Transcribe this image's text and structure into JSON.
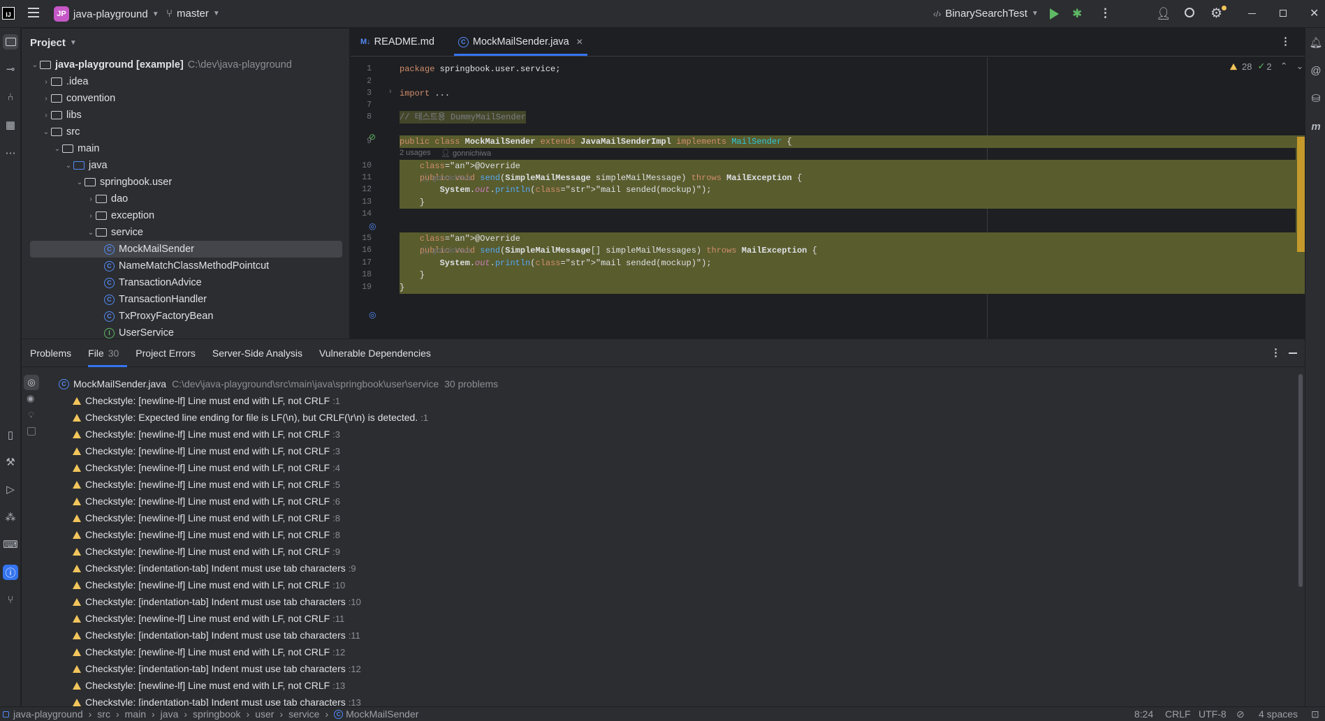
{
  "titlebar": {
    "project_badge": "JP",
    "project_name": "java-playground",
    "branch": "master",
    "run_config": "BinarySearchTest"
  },
  "project_panel": {
    "title": "Project",
    "tree": [
      {
        "label": "java-playground [example]",
        "extra": "C:\\dev\\java-playground",
        "type": "root",
        "depth": 0,
        "open": true
      },
      {
        "label": ".idea",
        "type": "folder",
        "depth": 1,
        "open": false
      },
      {
        "label": "convention",
        "type": "folder",
        "depth": 1,
        "open": false
      },
      {
        "label": "libs",
        "type": "folder",
        "depth": 1,
        "open": false
      },
      {
        "label": "src",
        "type": "folder",
        "depth": 1,
        "open": true
      },
      {
        "label": "main",
        "type": "folder",
        "depth": 2,
        "open": true
      },
      {
        "label": "java",
        "type": "folder",
        "depth": 3,
        "open": true
      },
      {
        "label": "springbook.user",
        "type": "package",
        "depth": 4,
        "open": true
      },
      {
        "label": "dao",
        "type": "package",
        "depth": 5,
        "open": false
      },
      {
        "label": "exception",
        "type": "package",
        "depth": 5,
        "open": false
      },
      {
        "label": "service",
        "type": "package",
        "depth": 5,
        "open": true
      },
      {
        "label": "MockMailSender",
        "type": "class",
        "depth": 6,
        "selected": true
      },
      {
        "label": "NameMatchClassMethodPointcut",
        "type": "class",
        "depth": 6
      },
      {
        "label": "TransactionAdvice",
        "type": "class",
        "depth": 6
      },
      {
        "label": "TransactionHandler",
        "type": "class",
        "depth": 6
      },
      {
        "label": "TxProxyFactoryBean",
        "type": "class",
        "depth": 6
      },
      {
        "label": "UserService",
        "type": "interface",
        "depth": 6
      }
    ]
  },
  "editor": {
    "tabs": [
      {
        "label": "README.md",
        "icon": "M↓"
      },
      {
        "label": "MockMailSender.java",
        "icon": "C",
        "active": true
      }
    ],
    "warnings_count": "28",
    "checks_count": "2",
    "hint_usages": "2 usages",
    "hint_author": "gonnichiwa",
    "lines": [
      {
        "no": "1",
        "code": "package springbook.user.service;"
      },
      {
        "no": "2",
        "code": ""
      },
      {
        "no": "3",
        "code": "import ..."
      },
      {
        "no": "7",
        "code": ""
      },
      {
        "no": "8",
        "code": "// 테스트용 DummyMailSender"
      },
      {
        "no": "9",
        "code": "public class MockMailSender extends JavaMailSenderImpl implements MailSender {"
      },
      {
        "no": "10",
        "code": "    @Override"
      },
      {
        "no": "11",
        "code": "    public void send(SimpleMailMessage simpleMailMessage) throws MailException {"
      },
      {
        "no": "12",
        "code": "        System.out.println(\"mail sended(mockup)\");"
      },
      {
        "no": "13",
        "code": "    }"
      },
      {
        "no": "14",
        "code": ""
      },
      {
        "no": "15",
        "code": "    @Override"
      },
      {
        "no": "16",
        "code": "    public void send(SimpleMailMessage[] simpleMailMessages) throws MailException {"
      },
      {
        "no": "17",
        "code": "        System.out.println(\"mail sended(mockup)\");"
      },
      {
        "no": "18",
        "code": "    }"
      },
      {
        "no": "19",
        "code": "}"
      }
    ]
  },
  "problems": {
    "tabs": [
      {
        "label": "Problems"
      },
      {
        "label": "File",
        "count": "30",
        "active": true
      },
      {
        "label": "Project Errors"
      },
      {
        "label": "Server-Side Analysis"
      },
      {
        "label": "Vulnerable Dependencies"
      }
    ],
    "file_name": "MockMailSender.java",
    "file_path": "C:\\dev\\java-playground\\src\\main\\java\\springbook\\user\\service",
    "file_count": "30 problems",
    "items": [
      {
        "text": "Checkstyle: [newline-lf] Line must end with LF, not CRLF",
        "line": ":1"
      },
      {
        "text": "Checkstyle: Expected line ending for file is LF(\\n), but CRLF(\\r\\n) is detected.",
        "line": ":1"
      },
      {
        "text": "Checkstyle: [newline-lf] Line must end with LF, not CRLF",
        "line": ":3"
      },
      {
        "text": "Checkstyle: [newline-lf] Line must end with LF, not CRLF",
        "line": ":3"
      },
      {
        "text": "Checkstyle: [newline-lf] Line must end with LF, not CRLF",
        "line": ":4"
      },
      {
        "text": "Checkstyle: [newline-lf] Line must end with LF, not CRLF",
        "line": ":5"
      },
      {
        "text": "Checkstyle: [newline-lf] Line must end with LF, not CRLF",
        "line": ":6"
      },
      {
        "text": "Checkstyle: [newline-lf] Line must end with LF, not CRLF",
        "line": ":8"
      },
      {
        "text": "Checkstyle: [newline-lf] Line must end with LF, not CRLF",
        "line": ":8"
      },
      {
        "text": "Checkstyle: [newline-lf] Line must end with LF, not CRLF",
        "line": ":9"
      },
      {
        "text": "Checkstyle: [indentation-tab] Indent must use tab characters",
        "line": ":9"
      },
      {
        "text": "Checkstyle: [newline-lf] Line must end with LF, not CRLF",
        "line": ":10"
      },
      {
        "text": "Checkstyle: [indentation-tab] Indent must use tab characters",
        "line": ":10"
      },
      {
        "text": "Checkstyle: [newline-lf] Line must end with LF, not CRLF",
        "line": ":11"
      },
      {
        "text": "Checkstyle: [indentation-tab] Indent must use tab characters",
        "line": ":11"
      },
      {
        "text": "Checkstyle: [newline-lf] Line must end with LF, not CRLF",
        "line": ":12"
      },
      {
        "text": "Checkstyle: [indentation-tab] Indent must use tab characters",
        "line": ":12"
      },
      {
        "text": "Checkstyle: [newline-lf] Line must end with LF, not CRLF",
        "line": ":13"
      },
      {
        "text": "Checkstyle: [indentation-tab] Indent must use tab characters",
        "line": ":13"
      }
    ]
  },
  "statusbar": {
    "breadcrumb": [
      "java-playground",
      "src",
      "main",
      "java",
      "springbook",
      "user",
      "service",
      "MockMailSender"
    ],
    "position": "8:24",
    "line_sep": "CRLF",
    "encoding": "UTF-8",
    "indent": "4 spaces"
  },
  "colors": {
    "accent": "#3574f0",
    "warning": "#f2c55c",
    "highlight": "#595c2d"
  }
}
